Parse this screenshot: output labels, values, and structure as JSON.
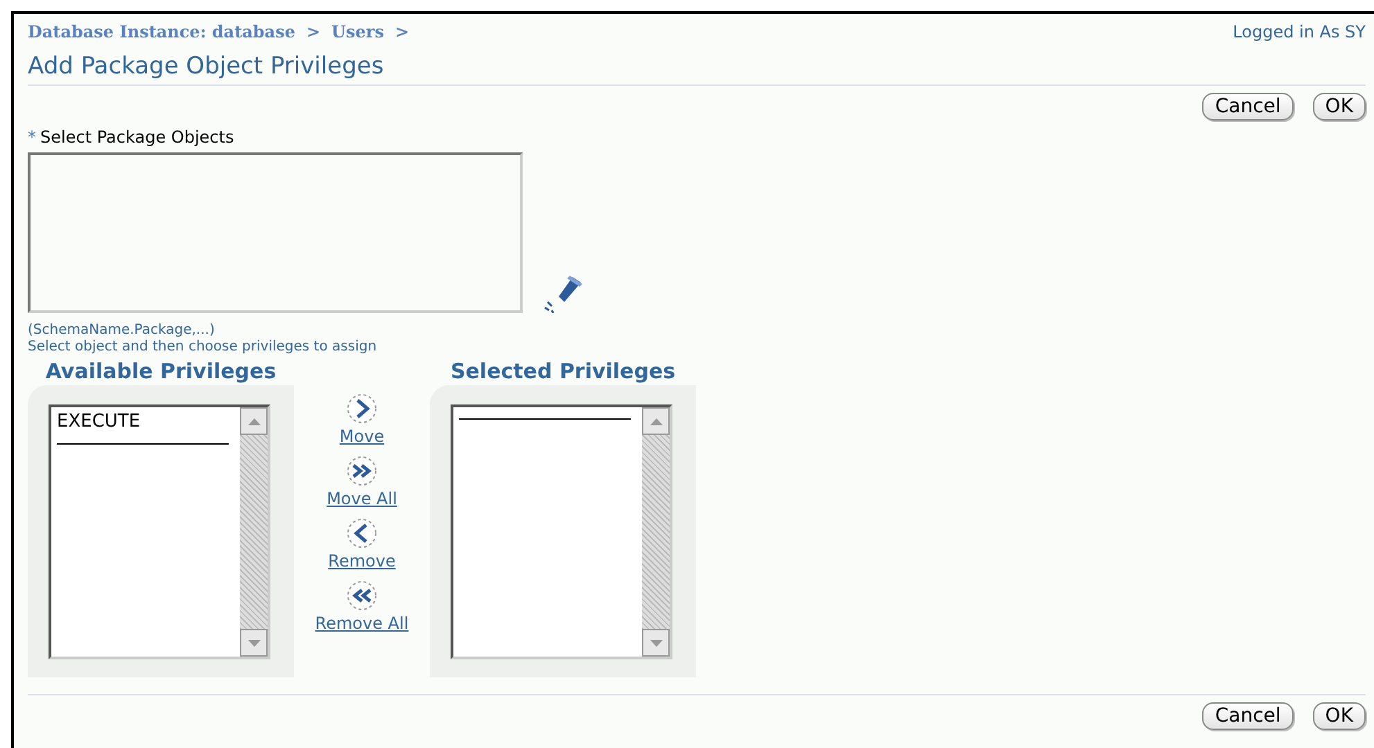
{
  "breadcrumb": [
    {
      "label": "Database Instance: database",
      "separator": ">"
    },
    {
      "label": "Users",
      "separator": ">"
    }
  ],
  "login_status": "Logged in As SY",
  "title": "Add Package Object Privileges",
  "top_buttons": [
    "Cancel",
    "OK"
  ],
  "package_objects": {
    "label": "Select Package Objects",
    "required_mark": "*",
    "hint": "(SchemaName.Package,...)"
  },
  "instruction": "Select object and then choose privileges to assign",
  "available": {
    "heading": "Available Privileges",
    "items": [
      {
        "label": "EXECUTE",
        "selected": false
      }
    ]
  },
  "selected": {
    "heading": "Selected Privileges"
  },
  "shuttle_actions": [
    {
      "kind": "move",
      "label": "Move"
    },
    {
      "kind": "move_all",
      "label": "Move All"
    },
    {
      "kind": "remove",
      "label": "Remove"
    },
    {
      "kind": "remove_all",
      "label": "Remove All"
    }
  ],
  "bottom_buttons": [
    "Cancel",
    "OK"
  ]
}
